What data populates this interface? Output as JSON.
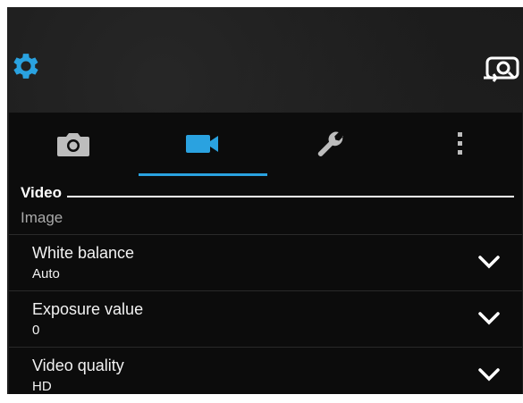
{
  "theme": {
    "accent": "#2aa2e0",
    "background": "#0c0c0c",
    "text": "#f2f2f2",
    "muted": "#a9a9a9"
  },
  "toolbar": {
    "settings_icon": "gear-icon",
    "switch_icon": "switch-camera-icon"
  },
  "tabs": [
    {
      "icon": "camera-icon",
      "active": false
    },
    {
      "icon": "video-camera-icon",
      "active": true
    },
    {
      "icon": "wrench-icon",
      "active": false
    },
    {
      "icon": "more-vertical-icon",
      "active": false
    }
  ],
  "section": {
    "header": "Video",
    "subheader": "Image"
  },
  "settings": [
    {
      "title": "White balance",
      "value": "Auto"
    },
    {
      "title": "Exposure value",
      "value": "0"
    },
    {
      "title": "Video quality",
      "value": "HD"
    }
  ]
}
